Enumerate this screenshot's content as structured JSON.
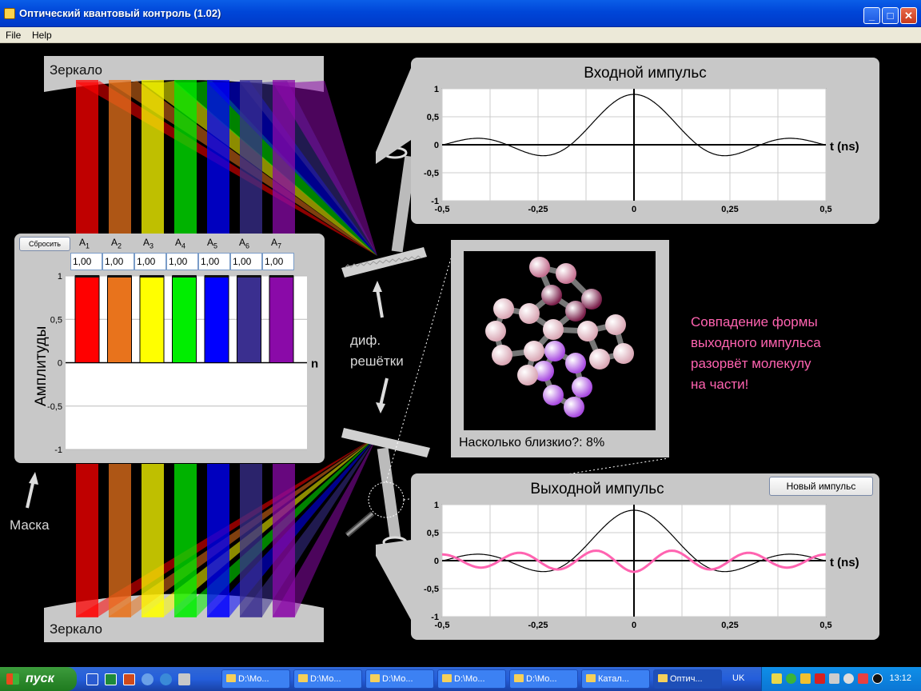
{
  "window": {
    "title": "Оптический квантовый контроль (1.02)",
    "min": "_",
    "max": "□",
    "close": "✕"
  },
  "menu": {
    "file": "File",
    "help": "Help"
  },
  "labels": {
    "mirror_top": "Зеркало",
    "mirror_bottom": "Зеркало",
    "mask": "Маска",
    "gratings_1": "диф.",
    "gratings_2": "решётки",
    "message": [
      "Совпадение формы",
      "выходного импульса",
      "разорвёт молекулу",
      "на части!"
    ]
  },
  "amplitudes": {
    "reset_label": "Сбросить",
    "ylabel": "Амплитуды",
    "xlabel": "n",
    "columns": [
      {
        "name": "A",
        "sub": "1",
        "value": "1,00",
        "color": "#ff0000"
      },
      {
        "name": "A",
        "sub": "2",
        "value": "1,00",
        "color": "#e8731c"
      },
      {
        "name": "A",
        "sub": "3",
        "value": "1,00",
        "color": "#ffff00"
      },
      {
        "name": "A",
        "sub": "4",
        "value": "1,00",
        "color": "#00ee00"
      },
      {
        "name": "A",
        "sub": "5",
        "value": "1,00",
        "color": "#0000ff"
      },
      {
        "name": "A",
        "sub": "6",
        "value": "1,00",
        "color": "#3a2f8f"
      },
      {
        "name": "A",
        "sub": "7",
        "value": "1,00",
        "color": "#8a0aa8"
      }
    ],
    "y_ticks": [
      "1",
      "0,5",
      "0",
      "-0,5",
      "-1"
    ]
  },
  "input_pulse": {
    "title": "Входной импульс",
    "t_label": "t (ns)"
  },
  "output_pulse": {
    "title": "Выходной импульс",
    "t_label": "t (ns)",
    "button": "Новый импульс"
  },
  "molecule": {
    "closeness": "Насколько близкио?: 8%"
  },
  "chart_data": [
    {
      "type": "line",
      "title": "Входной импульс",
      "xlabel": "t (ns)",
      "ylabel": "",
      "xlim": [
        -0.5,
        0.5
      ],
      "ylim": [
        -1,
        1
      ],
      "x_ticks": [
        "-0,5",
        "-0,25",
        "0",
        "0,25",
        "0,5"
      ],
      "y_ticks": [
        "1",
        "0,5",
        "0",
        "-0,5",
        "-1"
      ],
      "grid": true,
      "series": [
        {
          "color": "#000000",
          "formula": "sinc",
          "x": [
            -0.5,
            -0.4,
            -0.3,
            -0.2,
            -0.17,
            -0.1,
            0,
            0.1,
            0.2,
            0.3,
            0.4,
            0.5
          ],
          "y": [
            -0.08,
            -0.12,
            -0.05,
            -0.12,
            0.03,
            -0.28,
            0.9,
            -0.28,
            -0.08,
            -0.13,
            -0.05,
            -0.1
          ]
        }
      ]
    },
    {
      "type": "line",
      "title": "Выходной импульс",
      "xlabel": "t (ns)",
      "ylabel": "",
      "xlim": [
        -0.5,
        0.5
      ],
      "ylim": [
        -1,
        1
      ],
      "x_ticks": [
        "-0,5",
        "-0,25",
        "0",
        "0,25",
        "0,5"
      ],
      "y_ticks": [
        "1",
        "0,5",
        "0",
        "-0,5",
        "-1"
      ],
      "grid": true,
      "series": [
        {
          "color": "#000000",
          "x": [
            -0.5,
            -0.4,
            -0.3,
            -0.2,
            -0.1,
            0,
            0.1,
            0.2,
            0.3,
            0.4,
            0.5
          ],
          "y": [
            -0.08,
            -0.12,
            -0.05,
            -0.12,
            -0.28,
            0.9,
            -0.28,
            -0.08,
            -0.13,
            -0.05,
            -0.1
          ]
        },
        {
          "color": "#ff63b0",
          "x": [
            -0.5,
            -0.4,
            -0.3,
            -0.2,
            -0.1,
            0,
            0.1,
            0.2,
            0.3,
            0.4,
            0.5
          ],
          "y": [
            0,
            0.05,
            -0.1,
            -0.2,
            0.2,
            -0.2,
            0.2,
            0.05,
            -0.2,
            0.05,
            0
          ]
        }
      ]
    },
    {
      "type": "bar",
      "title": "",
      "xlabel": "n",
      "ylabel": "Амплитуды",
      "categories": [
        "A1",
        "A2",
        "A3",
        "A4",
        "A5",
        "A6",
        "A7"
      ],
      "values": [
        1,
        1,
        1,
        1,
        1,
        1,
        1
      ],
      "ylim": [
        -1,
        1
      ]
    }
  ],
  "taskbar": {
    "start": "пуск",
    "tasks": [
      "D:\\Mo...",
      "D:\\Mo...",
      "D:\\Mo...",
      "D:\\Mo...",
      "D:\\Mo...",
      "Катал...",
      "Оптич..."
    ],
    "lang": "UK",
    "clock": "13:12"
  }
}
